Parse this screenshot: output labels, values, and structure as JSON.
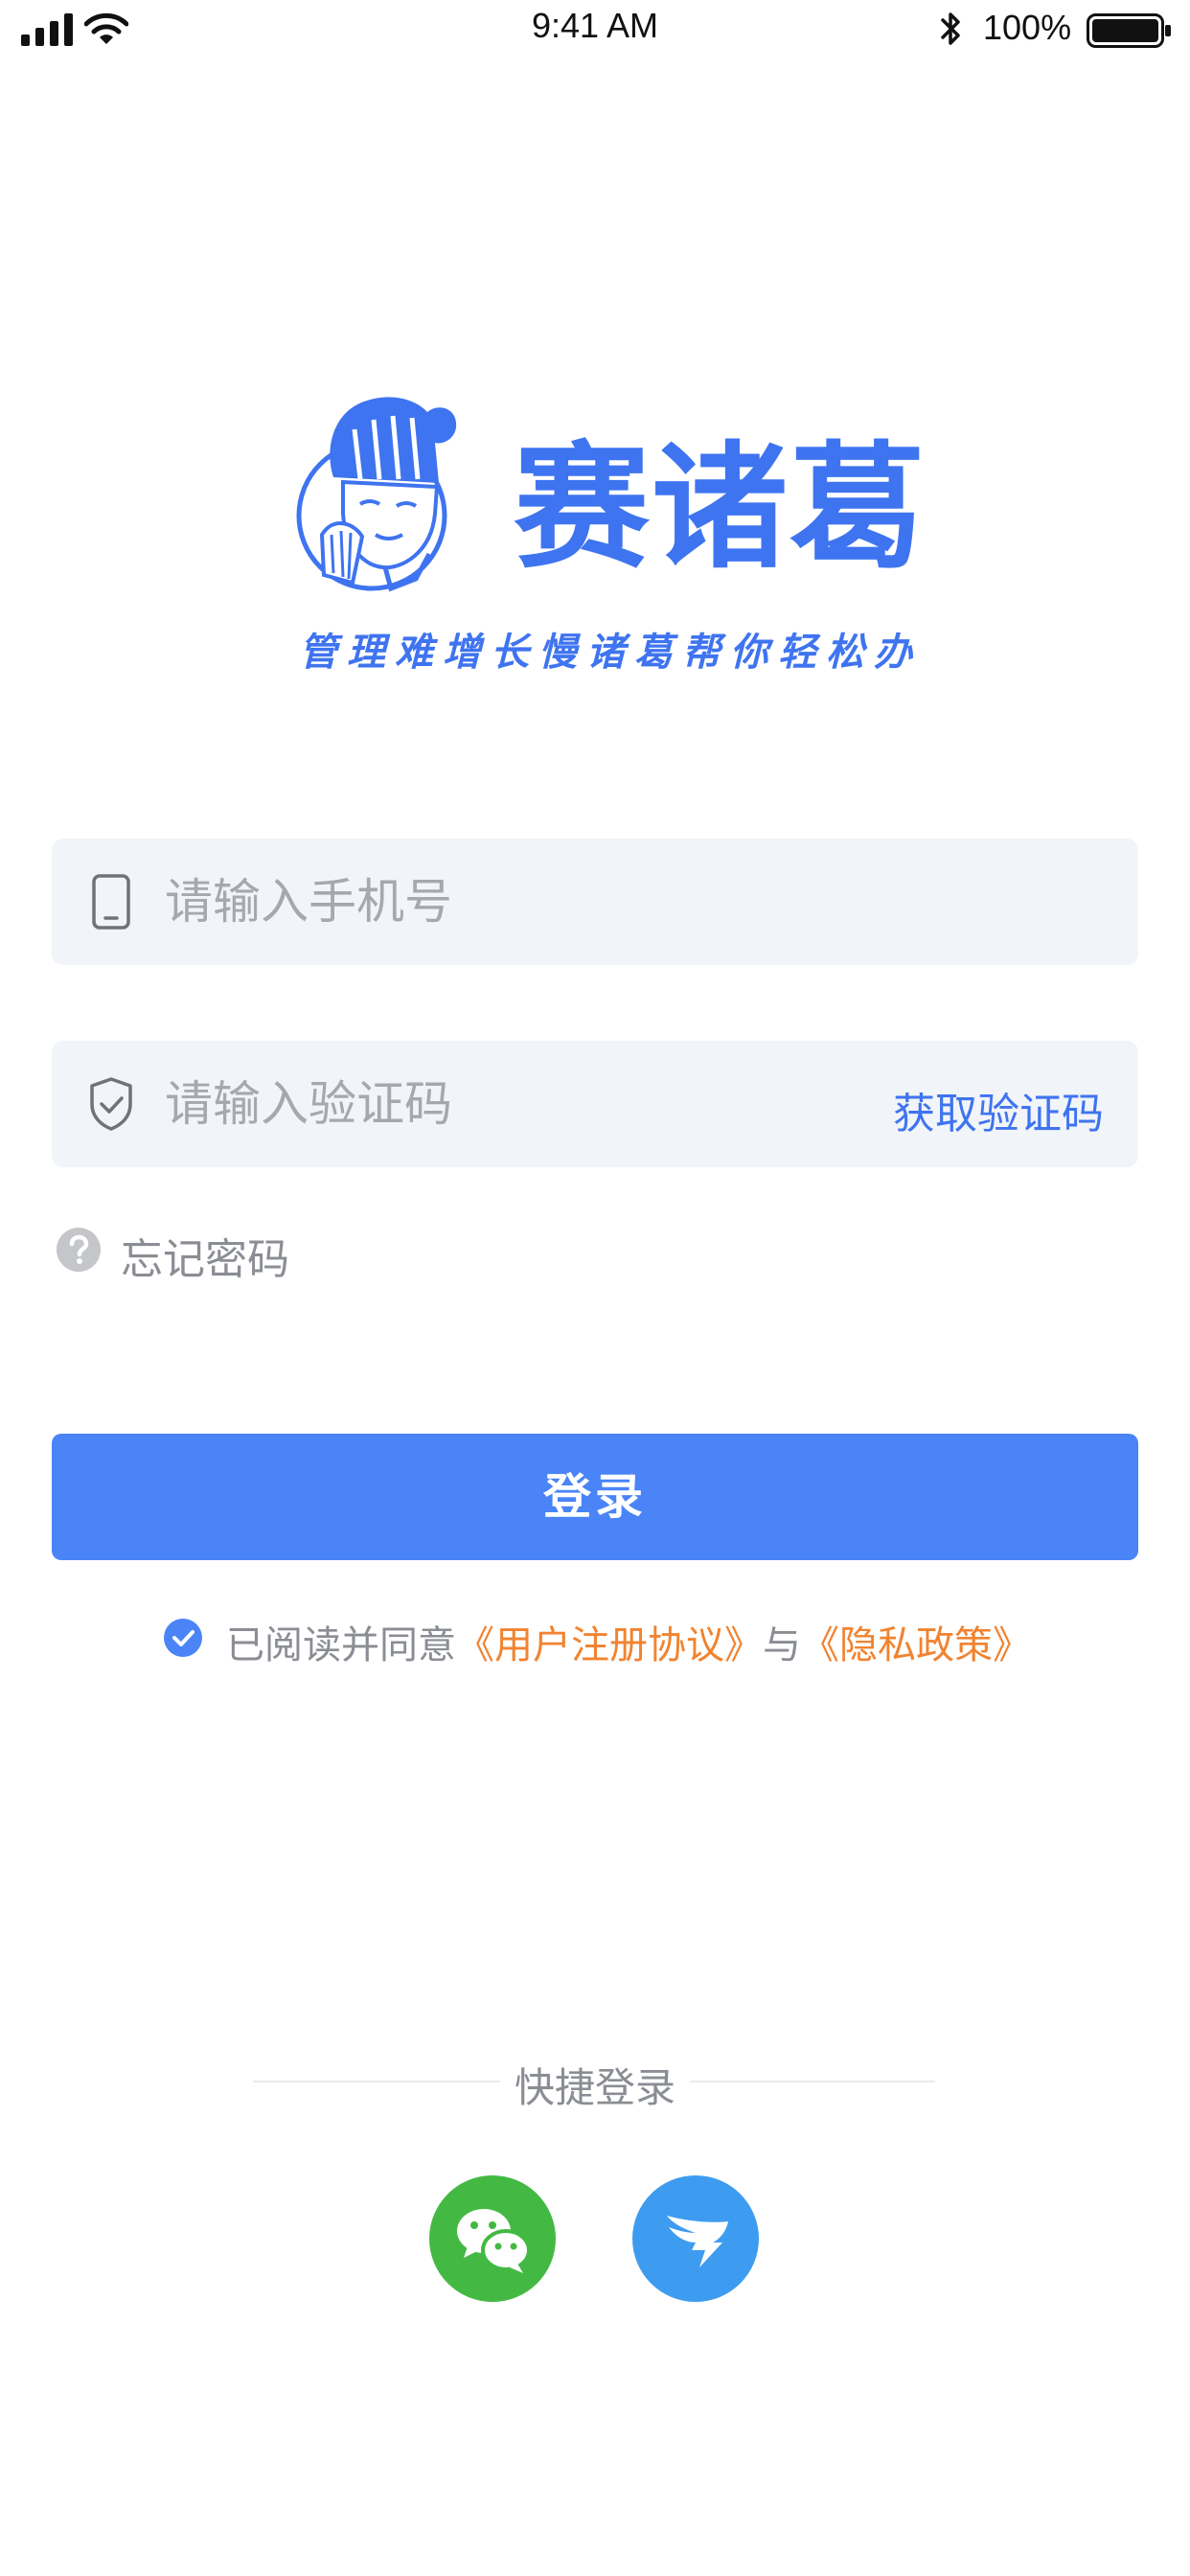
{
  "status_bar": {
    "time": "9:41 AM",
    "battery": "100%"
  },
  "brand": {
    "name": "赛诸葛",
    "slogan": "管理难增长慢诸葛帮你轻松办",
    "color": "#3f74f0"
  },
  "phone_field": {
    "placeholder": "请输入手机号",
    "icon": "phone-icon"
  },
  "code_field": {
    "placeholder": "请输入验证码",
    "icon": "shield-icon",
    "get_code_label": "获取验证码"
  },
  "forgot_password": {
    "label": "忘记密码",
    "icon": "question-icon"
  },
  "login_button": {
    "label": "登录",
    "color": "#4a84f7"
  },
  "agreement": {
    "checked": true,
    "prefix": "已阅读并同意",
    "user_agreement": "《用户注册协议》",
    "connector": "与",
    "privacy_policy": "《隐私政策》",
    "link_color": "#f18330"
  },
  "quick_login": {
    "title": "快捷登录",
    "providers": [
      {
        "icon": "wechat-icon",
        "color": "#43b943"
      },
      {
        "icon": "dingtalk-icon",
        "color": "#3d9cf0"
      }
    ]
  }
}
